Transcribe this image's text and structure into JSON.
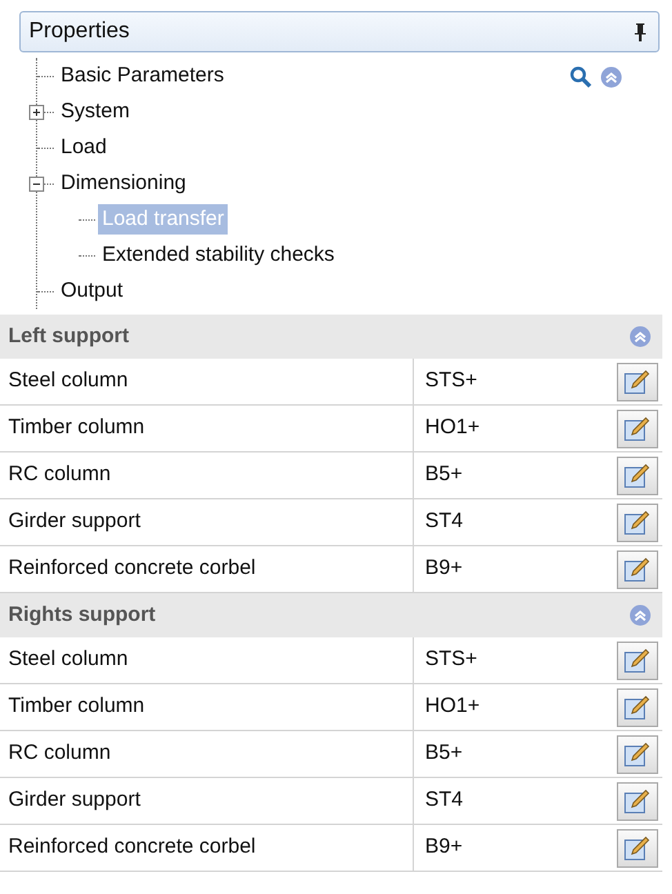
{
  "panel": {
    "title": "Properties",
    "pinned": true
  },
  "tree": [
    {
      "label": "Basic Parameters",
      "selected": false
    },
    {
      "label": "System",
      "selected": false,
      "expanded": false
    },
    {
      "label": "Load",
      "selected": false
    },
    {
      "label": "Dimensioning",
      "selected": false,
      "expanded": true,
      "children": [
        {
          "label": "Load transfer",
          "selected": true
        },
        {
          "label": "Extended stability checks",
          "selected": false
        }
      ]
    },
    {
      "label": "Output",
      "selected": false
    }
  ],
  "sections": [
    {
      "title": "Left support",
      "expanded": true,
      "rows": [
        {
          "name": "Steel column",
          "value": "STS+"
        },
        {
          "name": "Timber column",
          "value": "HO1+"
        },
        {
          "name": "RC column",
          "value": "B5+"
        },
        {
          "name": "Girder support",
          "value": "ST4"
        },
        {
          "name": "Reinforced concrete corbel",
          "value": "B9+"
        }
      ]
    },
    {
      "title": "Rights support",
      "expanded": true,
      "rows": [
        {
          "name": "Steel column",
          "value": "STS+"
        },
        {
          "name": "Timber column",
          "value": "HO1+"
        },
        {
          "name": "RC column",
          "value": "B5+"
        },
        {
          "name": "Girder support",
          "value": "ST4"
        },
        {
          "name": "Reinforced concrete corbel",
          "value": "B9+"
        }
      ]
    }
  ]
}
